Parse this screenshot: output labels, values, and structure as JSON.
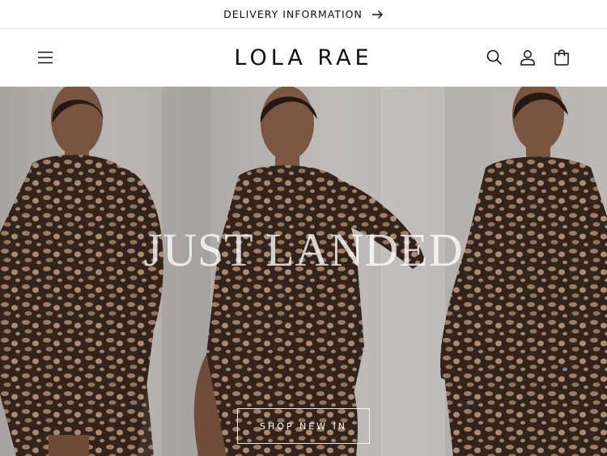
{
  "announcement": {
    "text": "DELIVERY INFORMATION",
    "icon": "arrow-right-icon"
  },
  "header": {
    "logo_text": "LOLA RAE",
    "icons": [
      "menu-icon",
      "search-icon",
      "account-icon",
      "cart-icon"
    ]
  },
  "hero": {
    "title": "JUST LANDED",
    "button_label": "SHOP NEW IN"
  },
  "colors": {
    "text": "#121212",
    "background": "#ffffff",
    "hero_text": "#ffffff"
  }
}
